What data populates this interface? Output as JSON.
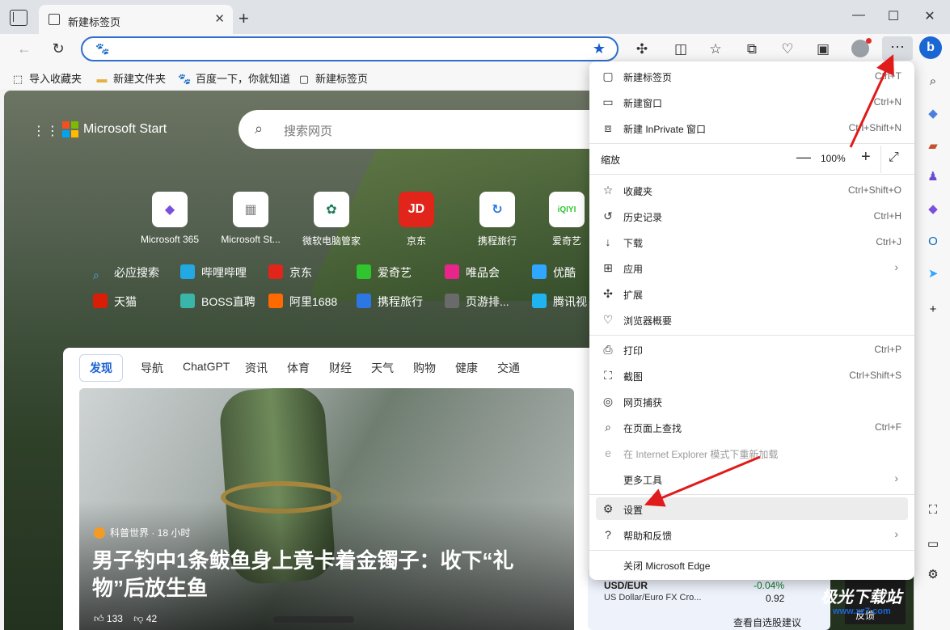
{
  "tab": {
    "title": "新建标签页"
  },
  "favorites": [
    {
      "label": "导入收藏夹",
      "icon": "import-favorites-icon"
    },
    {
      "label": "新建文件夹",
      "icon": "folder-icon"
    },
    {
      "label": "百度一下，你就知道",
      "icon": "baidu-icon"
    },
    {
      "label": "新建标签页",
      "icon": "newtab-page-icon"
    }
  ],
  "page": {
    "brand": "Microsoft Start",
    "search_placeholder": "搜索网页",
    "tiles": [
      {
        "label": "Microsoft 365",
        "glyph": "◆",
        "color": "#7a4fe0"
      },
      {
        "label": "Microsoft St...",
        "glyph": "▦",
        "color": "#888888"
      },
      {
        "label": "微软电脑管家",
        "glyph": "✿",
        "color": "#1e7d57"
      },
      {
        "label": "京东",
        "glyph": "JD",
        "color": "#e1251b"
      },
      {
        "label": "携程旅行",
        "glyph": "↻",
        "color": "#2d77e5"
      },
      {
        "label": "爱奇艺",
        "glyph": "iQIYI",
        "color": "#2ec52f"
      }
    ],
    "links_row1": [
      {
        "label": "必应搜索",
        "color": "#2d77e5"
      },
      {
        "label": "哔哩哔哩",
        "color": "#22a9e4"
      },
      {
        "label": "京东",
        "color": "#e1251b"
      },
      {
        "label": "爱奇艺",
        "color": "#2ec52f"
      },
      {
        "label": "唯品会",
        "color": "#e8258a"
      },
      {
        "label": "优酷",
        "color": "#2fa6ff"
      }
    ],
    "links_row2": [
      {
        "label": "天猫",
        "color": "#d81e06"
      },
      {
        "label": "BOSS直聘",
        "color": "#3ab5a9"
      },
      {
        "label": "阿里1688",
        "color": "#ff6a00"
      },
      {
        "label": "携程旅行",
        "color": "#2d77e5"
      },
      {
        "label": "页游排...",
        "color": "#6a6a6a"
      },
      {
        "label": "腾讯视",
        "color": "#1fb4f0"
      }
    ],
    "feed_tabs": [
      "发现",
      "导航",
      "ChatGPT",
      "资讯",
      "体育",
      "财经",
      "天气",
      "购物",
      "健康",
      "交通"
    ],
    "story": {
      "source": "科普世界 · 18 小时",
      "headline": "男子钓中1条鲅鱼身上竟卡着金镯子：收下“礼物”后放生鱼",
      "likes": "133",
      "dislikes": "42"
    },
    "stock": {
      "pair": "USD/EUR",
      "name": "US Dollar/Euro FX Cro...",
      "change": "-0.04%",
      "value": "0.92",
      "watch": "查看自选股建议"
    },
    "feedback": "反馈"
  },
  "menu": {
    "items": [
      {
        "label": "新建标签页",
        "shortcut": "Ctrl+T",
        "icon": "new-tab-icon"
      },
      {
        "label": "新建窗口",
        "shortcut": "Ctrl+N",
        "icon": "new-window-icon"
      },
      {
        "label": "新建 InPrivate 窗口",
        "shortcut": "Ctrl+Shift+N",
        "icon": "inprivate-icon"
      },
      {
        "label": "缩放",
        "zoom": "100%"
      },
      {
        "label": "收藏夹",
        "shortcut": "Ctrl+Shift+O",
        "icon": "favorites-icon"
      },
      {
        "label": "历史记录",
        "shortcut": "Ctrl+H",
        "icon": "history-icon"
      },
      {
        "label": "下载",
        "shortcut": "Ctrl+J",
        "icon": "download-icon"
      },
      {
        "label": "应用",
        "icon": "apps-icon"
      },
      {
        "label": "扩展",
        "icon": "extensions-icon"
      },
      {
        "label": "浏览器概要",
        "icon": "browser-essentials-icon"
      },
      {
        "label": "打印",
        "shortcut": "Ctrl+P",
        "icon": "print-icon"
      },
      {
        "label": "截图",
        "shortcut": "Ctrl+Shift+S",
        "icon": "screenshot-icon"
      },
      {
        "label": "网页捕获",
        "icon": "web-capture-icon"
      },
      {
        "label": "在页面上查找",
        "shortcut": "Ctrl+F",
        "icon": "find-icon"
      },
      {
        "label": "在 Internet Explorer 模式下重新加载",
        "icon": "ie-icon"
      },
      {
        "label": "更多工具"
      },
      {
        "label": "设置",
        "icon": "settings-icon"
      },
      {
        "label": "帮助和反馈",
        "icon": "help-icon"
      },
      {
        "label": "关闭 Microsoft Edge"
      }
    ]
  },
  "watermark": "极光下载站",
  "watermark_sub": "www.xz7.com"
}
